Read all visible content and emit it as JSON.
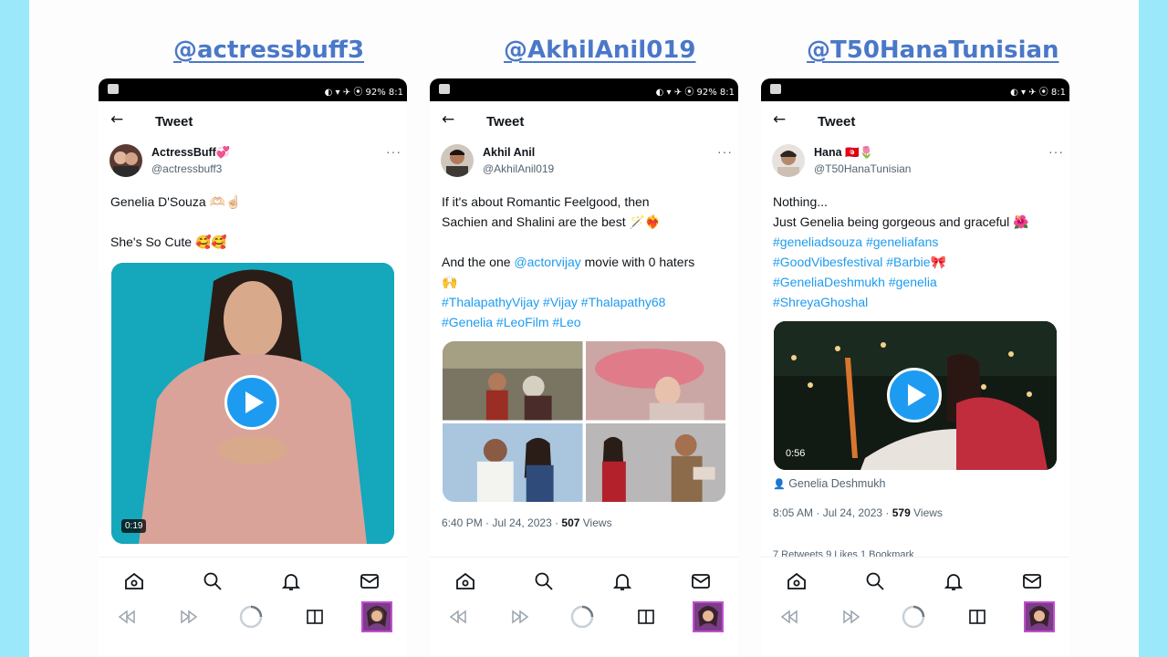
{
  "handles": [
    "@actressbuff3",
    "@AkhilAnil019",
    "@T50HanaTunisian"
  ],
  "phones": [
    {
      "status": "◐ ▾ ✈ ⦿ 92% 8:1",
      "topbar_title": "Tweet",
      "author_name": "ActressBuff💞",
      "author_handle": "@actressbuff3",
      "lines": [
        "Genelia D'Souza 🫶🏻☝🏻",
        "",
        "She's So Cute 🥰🥰"
      ],
      "duration": "0:19"
    },
    {
      "status": "◐ ▾ ✈ ⦿ 92% 8:1",
      "topbar_title": "Tweet",
      "author_name": "Akhil Anil",
      "author_handle": "@AkhilAnil019",
      "line1": "If it's about Romantic Feelgood, then",
      "line2": "Sachien and Shalini are the best 🪄❤️‍🔥",
      "line3_prefix": "And the one ",
      "line3_mention": "@actorvijay",
      "line3_suffix": " movie with 0 haters",
      "line4": "🙌",
      "line5": "#ThalapathyVijay  #Vijay #Thalapathy68",
      "line6": "#Genelia #LeoFilm #Leo",
      "meta_time": "6:40 PM · Jul 24, 2023 · ",
      "meta_views_count": "507",
      "meta_views_label": " Views"
    },
    {
      "status": "◐ ▾ ✈ ⦿ 8:1",
      "topbar_title": "Tweet",
      "author_name": "Hana 🇹🇳🌷",
      "author_handle": "@T50HanaTunisian",
      "line1": "Nothing...",
      "line2": "Just Genelia being gorgeous and graceful 🌺",
      "line3": "#geneliadsouza #geneliafans",
      "line4": "#GoodVibesfestival #Barbie🎀",
      "line5": "#GeneliaDeshmukh #genelia",
      "line6": "#ShreyaGhoshal",
      "duration": "0:56",
      "tagged": "Genelia Deshmukh",
      "meta_time": "8:05 AM · Jul 24, 2023 · ",
      "meta_views_count": "579",
      "meta_views_label": " Views",
      "stats_partial": "7 Retweets   9 Likes   1 Bookmark"
    }
  ],
  "icons": {
    "home": "home-icon",
    "search": "search-icon",
    "notifications": "bell-icon",
    "messages": "mail-icon",
    "rewind": "rewind-icon",
    "forward": "forward-icon",
    "spinner": "loading-spinner-icon",
    "recents": "recents-icon"
  },
  "colors": {
    "outer_bg": "#9be8fb",
    "handle_color": "#4a78c9",
    "twitter_blue": "#1d9bf0",
    "video_teal": "#15a7bc"
  }
}
